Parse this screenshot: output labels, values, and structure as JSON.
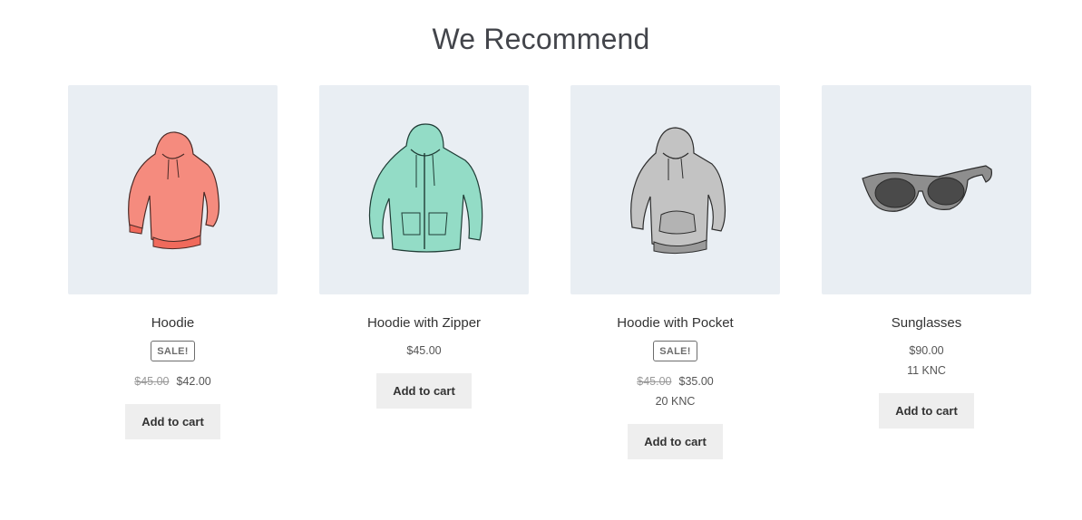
{
  "section": {
    "title": "We Recommend"
  },
  "products": [
    {
      "name": "Hoodie",
      "sale_badge": "SALE!",
      "price_old": "$45.00",
      "price": "$42.00",
      "knc": "",
      "button": "Add to cart",
      "icon": "hoodie-pink-icon",
      "color": "#f4867a"
    },
    {
      "name": "Hoodie with Zipper",
      "sale_badge": "",
      "price_old": "",
      "price": "$45.00",
      "knc": "",
      "button": "Add to cart",
      "icon": "hoodie-zipper-icon",
      "color": "#8fd8c2"
    },
    {
      "name": "Hoodie with Pocket",
      "sale_badge": "SALE!",
      "price_old": "$45.00",
      "price": "$35.00",
      "knc": "20 KNC",
      "button": "Add to cart",
      "icon": "hoodie-pocket-icon",
      "color": "#bdbdbd"
    },
    {
      "name": "Sunglasses",
      "sale_badge": "",
      "price_old": "",
      "price": "$90.00",
      "knc": "11 KNC",
      "button": "Add to cart",
      "icon": "sunglasses-icon",
      "color": "#8a8a8a"
    }
  ]
}
